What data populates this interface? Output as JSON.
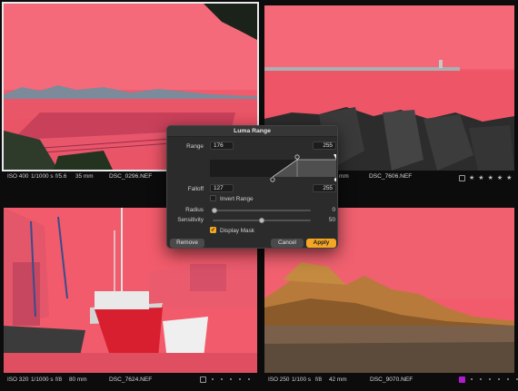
{
  "photos": [
    {
      "iso": "ISO 400",
      "shutter": "1/1000 s",
      "aperture": "f/5.6",
      "focal": "35 mm",
      "filename": "DSC_0296.NEF"
    },
    {
      "iso": "",
      "shutter": "",
      "aperture": "",
      "focal": "mm",
      "filename": "DSC_7606.NEF"
    },
    {
      "iso": "ISO 320",
      "shutter": "1/1000 s",
      "aperture": "f/8",
      "focal": "80 mm",
      "filename": "DSC_7624.NEF"
    },
    {
      "iso": "ISO 250",
      "shutter": "1/100 s",
      "aperture": "f/8",
      "focal": "42 mm",
      "filename": "DSC_9070.NEF"
    }
  ],
  "ratings": {
    "photo2": {
      "stars": [
        "★",
        "★",
        "★",
        "★",
        "★"
      ]
    },
    "photo4": {
      "color_label": "#b21ad0",
      "dots": 6
    }
  },
  "dialog": {
    "title": "Luma Range",
    "range_label": "Range",
    "range_low": "176",
    "range_high": "255",
    "falloff_label": "Falloff",
    "falloff_low": "127",
    "falloff_high": "255",
    "invert_label": "Invert Range",
    "invert_checked": false,
    "radius_label": "Radius",
    "radius_value": "0",
    "radius_level": 0.0,
    "sensitivity_label": "Sensitivity",
    "sensitivity_value": "50",
    "sensitivity_level": 0.5,
    "display_mask_label": "Display Mask",
    "display_mask_checked": true,
    "remove_label": "Remove",
    "cancel_label": "Cancel",
    "apply_label": "Apply",
    "checkmark": "✓"
  },
  "colors": {
    "mask": "#ff5e6e",
    "accent": "#f5a623",
    "selection": "#e9e9e9"
  }
}
